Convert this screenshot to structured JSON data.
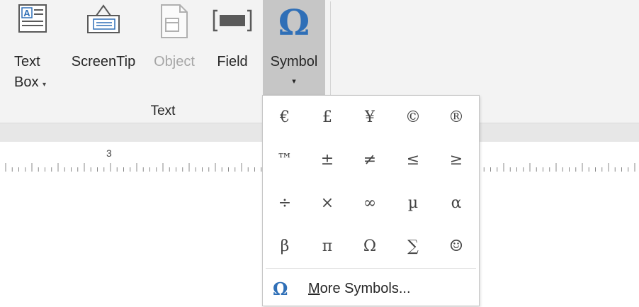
{
  "ribbon": {
    "buttons": [
      {
        "id": "textbox",
        "line1": "Text",
        "line2": "Box",
        "caret": "▾",
        "disabled": false
      },
      {
        "id": "screentip",
        "label": "ScreenTip",
        "disabled": false
      },
      {
        "id": "object",
        "label": "Object",
        "disabled": true
      },
      {
        "id": "field",
        "label": "Field",
        "disabled": false
      },
      {
        "id": "symbol",
        "label": "Symbol",
        "caret": "▾",
        "active": true,
        "icon_glyph": "Ω"
      }
    ],
    "group_label": "Text"
  },
  "ruler": {
    "marker": "3"
  },
  "symbol_menu": {
    "symbols": [
      "€",
      "£",
      "¥",
      "©",
      "®",
      "™",
      "±",
      "≠",
      "≤",
      "≥",
      "÷",
      "×",
      "∞",
      "µ",
      "α",
      "β",
      "π",
      "Ω",
      "∑",
      "☺"
    ],
    "more_icon": "Ω",
    "more_mnemonic": "M",
    "more_rest": "ore Symbols..."
  },
  "colors": {
    "accent": "#2f6fb7",
    "ribbon_bg": "#f3f3f3",
    "active_bg": "#c6c6c6"
  }
}
